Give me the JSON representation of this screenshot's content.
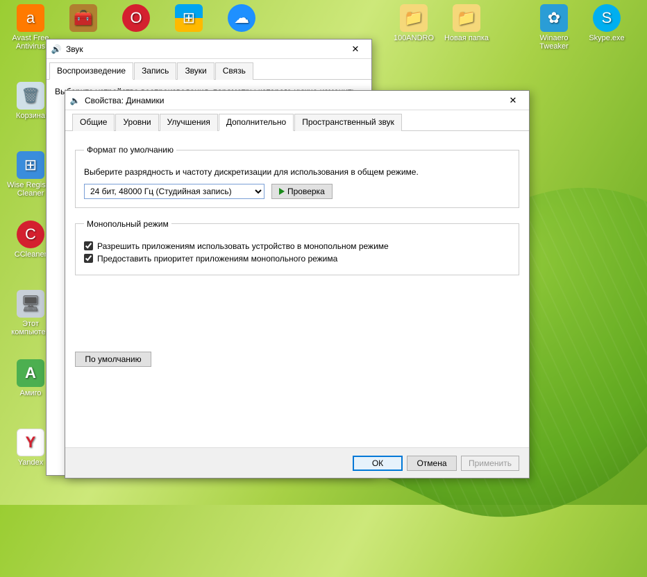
{
  "desktop_icons": {
    "row1": [
      {
        "label": "Avast Free Antivirus",
        "bg": "#ff7a00"
      },
      {
        "label": "",
        "bg": "#b08030"
      },
      {
        "label": "",
        "bg": "#d4202f"
      },
      {
        "label": "",
        "bg": "#00a4ef"
      },
      {
        "label": "",
        "bg": "#1e90ff"
      }
    ],
    "row1_right": [
      {
        "label": "100ANDRO",
        "bg": "#f5d87a"
      },
      {
        "label": "Новая папка",
        "bg": "#f5d87a"
      },
      {
        "label": "Winaero Tweaker",
        "bg": "#2a9dd6"
      },
      {
        "label": "Skype.exe",
        "bg": "#00aff0"
      }
    ],
    "col_left": [
      {
        "label": "Корзина",
        "bg": "#d0e0e8"
      },
      {
        "label": "Wise Registry Cleaner",
        "bg": "#3a8ddc"
      },
      {
        "label": "CCleaner",
        "bg": "#d4202f"
      },
      {
        "label": "Этот компьютер",
        "bg": "#c8d0d8"
      },
      {
        "label": "Амиго",
        "bg": "#4caf50"
      },
      {
        "label": "Yandex",
        "bg": "#ffffff"
      }
    ]
  },
  "sound_window": {
    "title": "Звук",
    "tabs": [
      "Воспроизведение",
      "Запись",
      "Звуки",
      "Связь"
    ],
    "active_tab": 0,
    "instruction": "Выберите устройство воспроизведения, параметры которого нужно изменить"
  },
  "props_window": {
    "title": "Свойства: Динамики",
    "tabs": [
      "Общие",
      "Уровни",
      "Улучшения",
      "Дополнительно",
      "Пространственный звук"
    ],
    "active_tab": 3,
    "group_format": {
      "legend": "Формат по умолчанию",
      "desc": "Выберите разрядность и частоту дискретизации для использования в общем режиме.",
      "combo_value": "24 бит, 48000 Гц (Студийная запись)",
      "test_btn": "Проверка"
    },
    "group_exclusive": {
      "legend": "Монопольный режим",
      "chk1": "Разрешить приложениям использовать устройство в монопольном режиме",
      "chk2": "Предоставить приоритет приложениям монопольного режима"
    },
    "defaults_btn": "По умолчанию",
    "footer": {
      "ok": "ОК",
      "cancel": "Отмена",
      "apply": "Применить"
    }
  }
}
